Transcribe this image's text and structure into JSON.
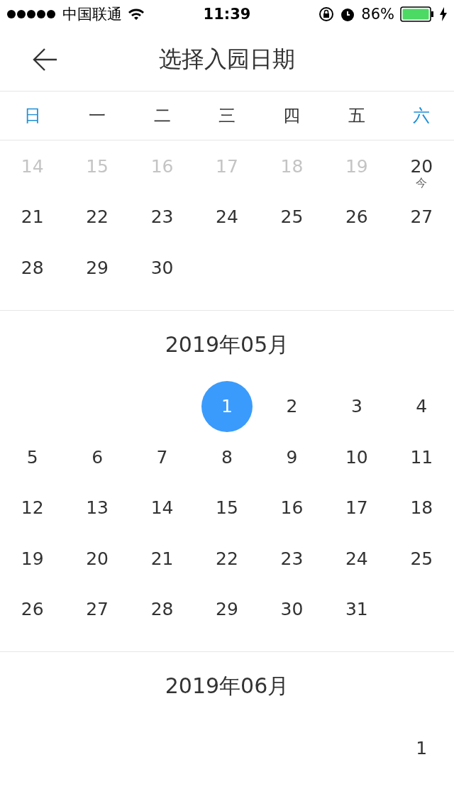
{
  "status_bar": {
    "carrier": "中国联通",
    "time": "11:39",
    "battery": "86%"
  },
  "header": {
    "title": "选择入园日期"
  },
  "weekdays": [
    {
      "label": "日",
      "weekend": true
    },
    {
      "label": "一",
      "weekend": false
    },
    {
      "label": "二",
      "weekend": false
    },
    {
      "label": "三",
      "weekend": false
    },
    {
      "label": "四",
      "weekend": false
    },
    {
      "label": "五",
      "weekend": false
    },
    {
      "label": "六",
      "weekend": true
    }
  ],
  "months": [
    {
      "weeks": [
        [
          {
            "kind": "day",
            "day": "14",
            "disabled": true,
            "selected": false
          },
          {
            "kind": "day",
            "day": "15",
            "disabled": true,
            "selected": false
          },
          {
            "kind": "day",
            "day": "16",
            "disabled": true,
            "selected": false
          },
          {
            "kind": "day",
            "day": "17",
            "disabled": true,
            "selected": false
          },
          {
            "kind": "day",
            "day": "18",
            "disabled": true,
            "selected": false
          },
          {
            "kind": "day",
            "day": "19",
            "disabled": true,
            "selected": false
          },
          {
            "kind": "day",
            "day": "20",
            "note": "今",
            "disabled": false,
            "selected": false
          }
        ],
        [
          {
            "kind": "day",
            "day": "21",
            "disabled": false,
            "selected": false
          },
          {
            "kind": "day",
            "day": "22",
            "disabled": false,
            "selected": false
          },
          {
            "kind": "day",
            "day": "23",
            "disabled": false,
            "selected": false
          },
          {
            "kind": "day",
            "day": "24",
            "disabled": false,
            "selected": false
          },
          {
            "kind": "day",
            "day": "25",
            "disabled": false,
            "selected": false
          },
          {
            "kind": "day",
            "day": "26",
            "disabled": false,
            "selected": false
          },
          {
            "kind": "day",
            "day": "27",
            "disabled": false,
            "selected": false
          }
        ],
        [
          {
            "kind": "day",
            "day": "28",
            "disabled": false,
            "selected": false
          },
          {
            "kind": "day",
            "day": "29",
            "disabled": false,
            "selected": false
          },
          {
            "kind": "day",
            "day": "30",
            "disabled": false,
            "selected": false
          },
          {
            "kind": "blank"
          },
          {
            "kind": "blank"
          },
          {
            "kind": "blank"
          },
          {
            "kind": "blank"
          }
        ]
      ]
    },
    {
      "title": "2019年05月",
      "weeks": [
        [
          {
            "kind": "blank"
          },
          {
            "kind": "blank"
          },
          {
            "kind": "blank"
          },
          {
            "kind": "day",
            "day": "1",
            "disabled": false,
            "selected": true
          },
          {
            "kind": "day",
            "day": "2",
            "disabled": false,
            "selected": false
          },
          {
            "kind": "day",
            "day": "3",
            "disabled": false,
            "selected": false
          },
          {
            "kind": "day",
            "day": "4",
            "disabled": false,
            "selected": false
          }
        ],
        [
          {
            "kind": "day",
            "day": "5",
            "disabled": false,
            "selected": false
          },
          {
            "kind": "day",
            "day": "6",
            "disabled": false,
            "selected": false
          },
          {
            "kind": "day",
            "day": "7",
            "disabled": false,
            "selected": false
          },
          {
            "kind": "day",
            "day": "8",
            "disabled": false,
            "selected": false
          },
          {
            "kind": "day",
            "day": "9",
            "disabled": false,
            "selected": false
          },
          {
            "kind": "day",
            "day": "10",
            "disabled": false,
            "selected": false
          },
          {
            "kind": "day",
            "day": "11",
            "disabled": false,
            "selected": false
          }
        ],
        [
          {
            "kind": "day",
            "day": "12",
            "disabled": false,
            "selected": false
          },
          {
            "kind": "day",
            "day": "13",
            "disabled": false,
            "selected": false
          },
          {
            "kind": "day",
            "day": "14",
            "disabled": false,
            "selected": false
          },
          {
            "kind": "day",
            "day": "15",
            "disabled": false,
            "selected": false
          },
          {
            "kind": "day",
            "day": "16",
            "disabled": false,
            "selected": false
          },
          {
            "kind": "day",
            "day": "17",
            "disabled": false,
            "selected": false
          },
          {
            "kind": "day",
            "day": "18",
            "disabled": false,
            "selected": false
          }
        ],
        [
          {
            "kind": "day",
            "day": "19",
            "disabled": false,
            "selected": false
          },
          {
            "kind": "day",
            "day": "20",
            "disabled": false,
            "selected": false
          },
          {
            "kind": "day",
            "day": "21",
            "disabled": false,
            "selected": false
          },
          {
            "kind": "day",
            "day": "22",
            "disabled": false,
            "selected": false
          },
          {
            "kind": "day",
            "day": "23",
            "disabled": false,
            "selected": false
          },
          {
            "kind": "day",
            "day": "24",
            "disabled": false,
            "selected": false
          },
          {
            "kind": "day",
            "day": "25",
            "disabled": false,
            "selected": false
          }
        ],
        [
          {
            "kind": "day",
            "day": "26",
            "disabled": false,
            "selected": false
          },
          {
            "kind": "day",
            "day": "27",
            "disabled": false,
            "selected": false
          },
          {
            "kind": "day",
            "day": "28",
            "disabled": false,
            "selected": false
          },
          {
            "kind": "day",
            "day": "29",
            "disabled": false,
            "selected": false
          },
          {
            "kind": "day",
            "day": "30",
            "disabled": false,
            "selected": false
          },
          {
            "kind": "day",
            "day": "31",
            "disabled": false,
            "selected": false
          },
          {
            "kind": "blank"
          }
        ]
      ]
    },
    {
      "title": "2019年06月",
      "weeks": [
        [
          {
            "kind": "blank"
          },
          {
            "kind": "blank"
          },
          {
            "kind": "blank"
          },
          {
            "kind": "blank"
          },
          {
            "kind": "blank"
          },
          {
            "kind": "blank"
          },
          {
            "kind": "day",
            "day": "1",
            "disabled": false,
            "selected": false
          }
        ]
      ]
    }
  ]
}
